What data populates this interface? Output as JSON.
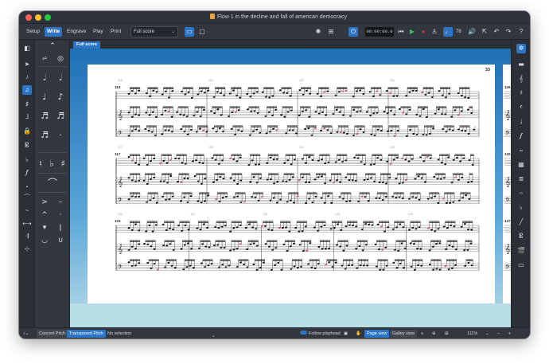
{
  "window": {
    "title": "Flow 1 in the decline and fall of american democracy"
  },
  "toolbar": {
    "modes": [
      "Setup",
      "Write",
      "Engrave",
      "Play",
      "Print"
    ],
    "active_mode": "Write",
    "layout_select": "Full score",
    "time_display": "00:00:00.0",
    "tempo_value": "76"
  },
  "document_tab": "Full score",
  "page": {
    "number": "33",
    "systems": [
      {
        "start_bar": "113",
        "bar_numbers": [
          "113",
          "114",
          "115",
          "116"
        ]
      },
      {
        "start_bar": "117",
        "bar_numbers": [
          "117",
          "118",
          "119",
          "120"
        ]
      },
      {
        "start_bar": "121",
        "bar_numbers": [
          "121",
          "122",
          "123",
          "124",
          "125"
        ]
      }
    ],
    "next_page_bars": [
      "126",
      "132",
      "137"
    ]
  },
  "statusbar": {
    "concert_pitch": "Concert Pitch",
    "transposed_pitch": "Transposed Pitch",
    "selection": "No selection",
    "follow_playhead": "Follow playhead",
    "page_view": "Page view",
    "galley_view": "Galley view",
    "zoom": "111%"
  },
  "colors": {
    "accent": "#2d74c4",
    "canvas_top": "#1e6fb5",
    "canvas_bottom": "#b9dde5",
    "highlight_note": "#e0548c"
  }
}
